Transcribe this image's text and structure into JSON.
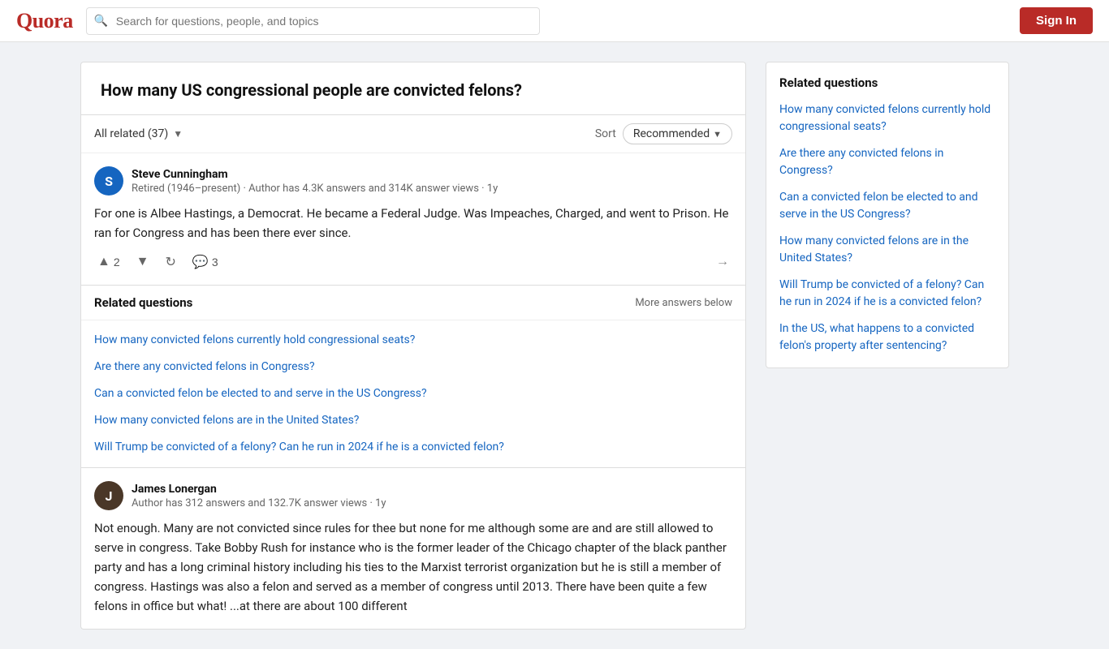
{
  "header": {
    "logo": "Quora",
    "search_placeholder": "Search for questions, people, and topics",
    "sign_in_label": "Sign In"
  },
  "question": {
    "title": "How many US congressional people are convicted felons?"
  },
  "answers_toolbar": {
    "all_related_label": "All related (37)",
    "sort_label": "Sort",
    "recommended_label": "Recommended"
  },
  "answers": [
    {
      "author_initial": "S",
      "author_name": "Steve Cunningham",
      "author_meta": "Retired (1946–present) · Author has 4.3K answers and 314K answer views · 1y",
      "upvotes": "2",
      "comments": "3",
      "text": "For one is Albee Hastings, a Democrat. He became a Federal Judge. Was Impeaches, Charged, and went to Prison. He ran for Congress and has been there ever since."
    },
    {
      "author_initial": "J",
      "author_name": "James Lonergan",
      "author_meta": "Author has 312 answers and 132.7K answer views · 1y",
      "upvotes": "",
      "comments": "",
      "text": "Not enough. Many are not convicted since rules for thee but none for me although some are and are still allowed to serve in congress. Take Bobby Rush for instance who is the former leader of the Chicago chapter of the black panther party and has a long criminal history including his ties to the Marxist terrorist organization but he is still a member of congress. Hastings was also a felon and served as a member of congress until 2013. There have been quite a few felons in office but what! ...at there are about 100 different"
    }
  ],
  "related_inline": {
    "title": "Related questions",
    "more_answers_label": "More answers below",
    "links": [
      "How many convicted felons currently hold congressional seats?",
      "Are there any convicted felons in Congress?",
      "Can a convicted felon be elected to and serve in the US Congress?",
      "How many convicted felons are in the United States?",
      "Will Trump be convicted of a felony? Can he run in 2024 if he is a convicted felon?"
    ]
  },
  "sidebar": {
    "title": "Related questions",
    "links": [
      "How many convicted felons currently hold congressional seats?",
      "Are there any convicted felons in Congress?",
      "Can a convicted felon be elected to and serve in the US Congress?",
      "How many convicted felons are in the United States?",
      "Will Trump be convicted of a felony? Can he run in 2024 if he is a convicted felon?",
      "In the US, what happens to a convicted felon's property after sentencing?"
    ]
  }
}
